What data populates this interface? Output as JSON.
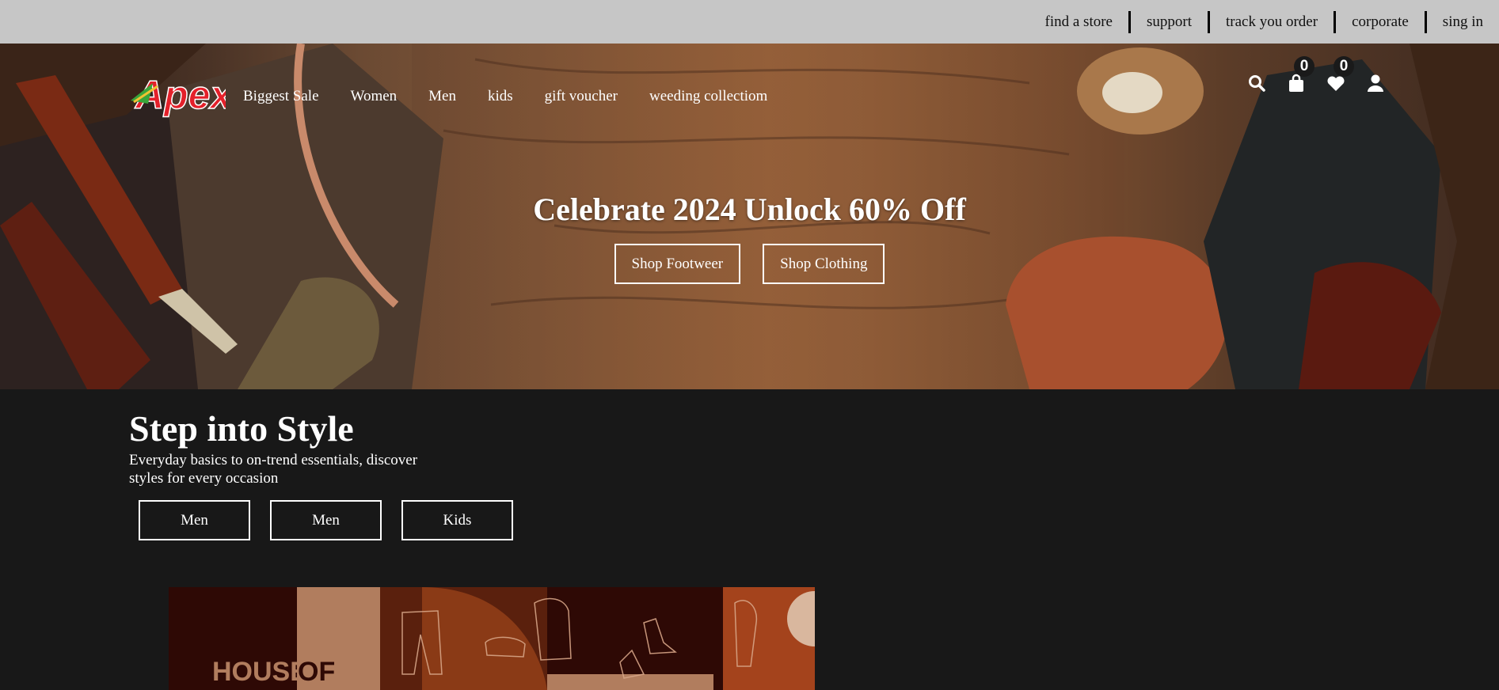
{
  "topbar": {
    "links": [
      "find a store",
      "support",
      "track you order",
      "corporate",
      "sing in"
    ]
  },
  "header": {
    "logo_text": "Apex",
    "nav": [
      "Biggest Sale",
      "Women",
      "Men",
      "kids",
      "gift voucher",
      "weeding collectiom"
    ],
    "icons": [
      "search-icon",
      "shopping-bag-icon",
      "heart-icon",
      "user-icon"
    ],
    "cart_count": "0",
    "wishlist_count": "0"
  },
  "hero": {
    "title": "Celebrate 2024 Unlock 60% Off",
    "buttons": [
      "Shop Footweer",
      "Shop Clothing"
    ]
  },
  "section": {
    "title": "Step into Style",
    "subtitle": "Everyday basics to on-trend essentials, discover styles for every occasion",
    "buttons": [
      "Men",
      "Men",
      "Kids"
    ]
  },
  "banner": {
    "text_house": "HOUSE",
    "text_of": "OF"
  },
  "colors": {
    "topbar_bg": "#c6c6c6",
    "page_bg": "#181818",
    "logo_red": "#e4202a",
    "banner_brown": "#7a2d12"
  }
}
